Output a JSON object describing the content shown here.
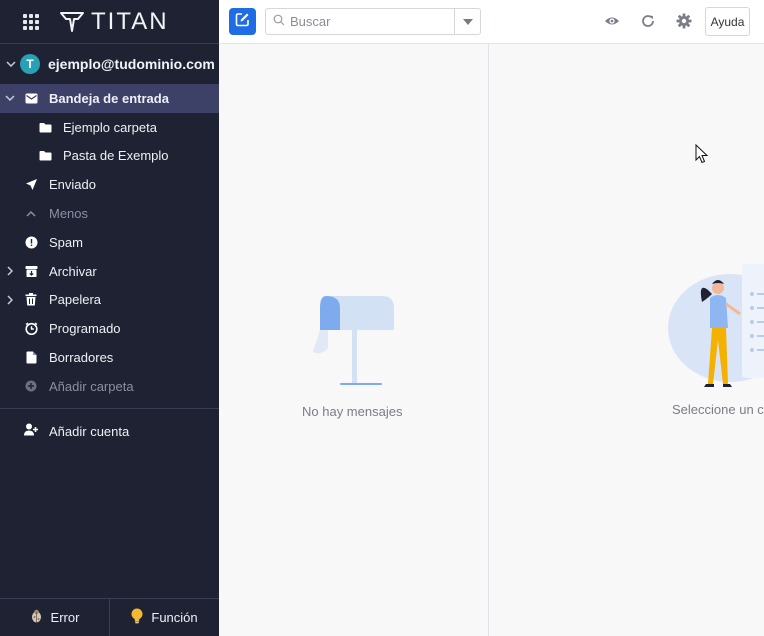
{
  "brand": {
    "name": "TITAN"
  },
  "account": {
    "initial": "T",
    "email": "ejemplo@tudominio.com"
  },
  "folders": [
    {
      "label": "Bandeja de entrada",
      "icon": "inbox-icon"
    },
    {
      "label": "Ejemplo carpeta",
      "icon": "folder-icon"
    },
    {
      "label": "Pasta de Exemplo",
      "icon": "folder-icon"
    },
    {
      "label": "Enviado",
      "icon": "send-icon"
    },
    {
      "label": "Menos",
      "icon": "chevron-up-icon"
    },
    {
      "label": "Spam",
      "icon": "spam-icon"
    },
    {
      "label": "Archivar",
      "icon": "archive-icon"
    },
    {
      "label": "Papelera",
      "icon": "trash-icon"
    },
    {
      "label": "Programado",
      "icon": "scheduled-icon"
    },
    {
      "label": "Borradores",
      "icon": "drafts-icon"
    },
    {
      "label": "Añadir carpeta",
      "icon": "add-icon"
    }
  ],
  "add_account": "Añadir cuenta",
  "bottom": {
    "error": "Error",
    "feature": "Función"
  },
  "search": {
    "placeholder": "Buscar"
  },
  "toolbar": {
    "help": "Ayuda"
  },
  "list_empty": "No hay mensajes",
  "reader_empty": "Seleccione un c",
  "colors": {
    "sidebar": "#1f2233",
    "active": "#3d4168",
    "accent": "#1f6de4",
    "avatar": "#2aa0b5"
  }
}
